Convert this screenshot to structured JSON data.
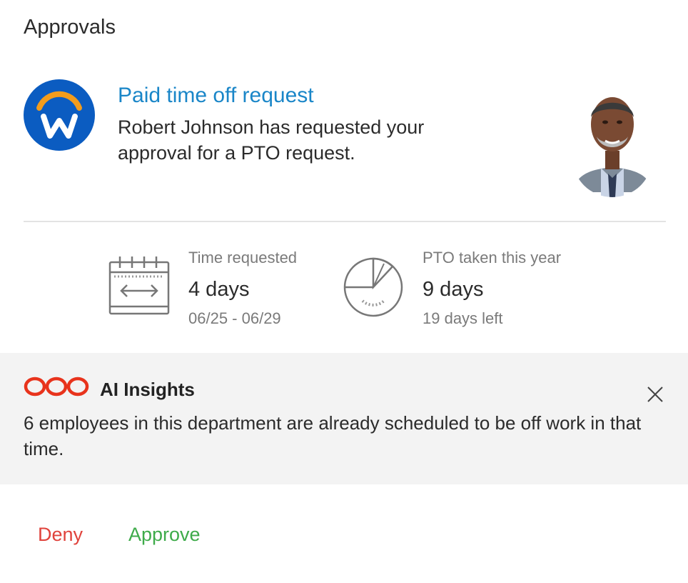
{
  "header": {
    "title": "Approvals"
  },
  "request": {
    "app_icon": "workday-logo",
    "title": "Paid time off request",
    "description": "Robert Johnson has requested your approval for a PTO request.",
    "avatar": "requester-avatar"
  },
  "stats": {
    "time_requested": {
      "icon": "calendar-range-icon",
      "label": "Time requested",
      "value": "4 days",
      "sub": "06/25 - 06/29"
    },
    "pto_taken": {
      "icon": "pie-chart-icon",
      "label": "PTO taken this year",
      "value": "9 days",
      "sub": "19 days left"
    }
  },
  "insights": {
    "icon": "infinity-loops-icon",
    "title": "AI Insights",
    "message": "6 employees in this department are already scheduled to be off work in that time.",
    "close_icon": "close-icon"
  },
  "actions": {
    "deny": "Deny",
    "approve": "Approve"
  },
  "colors": {
    "link_blue": "#1a86c8",
    "logo_blue": "#0b5cc1",
    "logo_orange": "#f39c1c",
    "deny_red": "#e0433c",
    "approve_green": "#3eab4a",
    "insights_bg": "#f3f3f3",
    "insights_icon": "#e8331c"
  }
}
